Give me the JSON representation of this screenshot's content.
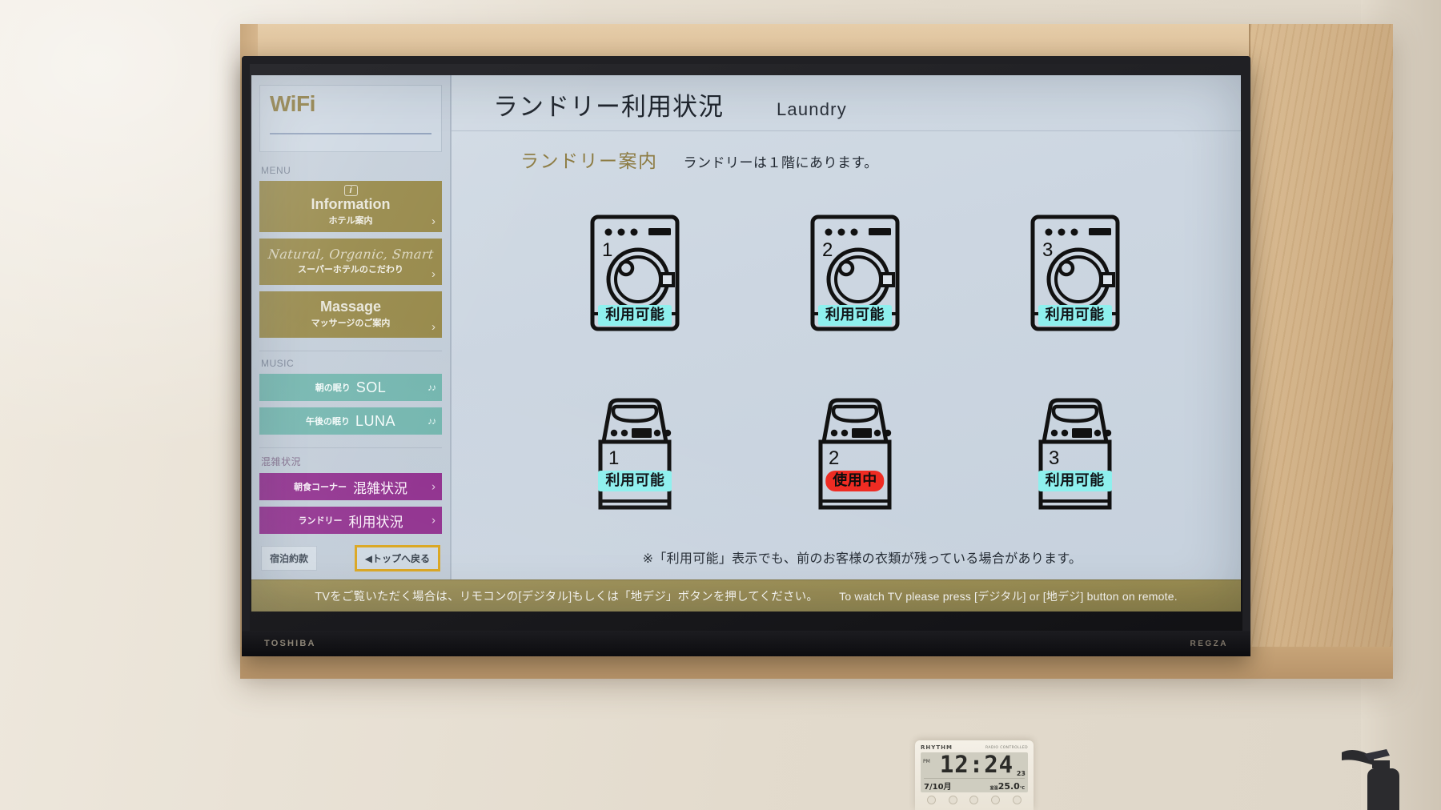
{
  "tv": {
    "brand_left": "TOSHIBA",
    "brand_right": "REGZA"
  },
  "sidebar": {
    "wifi_title": "WiFi",
    "menu_label": "MENU",
    "music_label": "MUSIC",
    "congestion_label": "混雑状況",
    "menu_items": [
      {
        "icon": "info-icon",
        "en": "Information",
        "ja": "ホテル案内",
        "chevron": "›"
      },
      {
        "script": "Natural, Organic, Smart",
        "ja": "スーパーホテルのこだわり",
        "chevron": "›"
      },
      {
        "en": "Massage",
        "ja": "マッサージのご案内",
        "chevron": "›"
      }
    ],
    "music_items": [
      {
        "ja": "朝の眠り",
        "en": "SOL",
        "note": "♪♪"
      },
      {
        "ja": "午後の眠り",
        "en": "LUNA",
        "note": "♪♪"
      }
    ],
    "congestion_items": [
      {
        "ja_small": "朝食コーナー",
        "ja_big": "混雑状況",
        "chevron": "›"
      },
      {
        "ja_small": "ランドリー",
        "ja_big": "利用状況",
        "chevron": "›"
      }
    ],
    "terms_button": "宿泊約款",
    "top_button": "◀トップへ戻る"
  },
  "main": {
    "title_ja": "ランドリー利用状況",
    "title_en": "Laundry",
    "sub_ja": "ランドリー案内",
    "sub_note": "ランドリーは１階にあります。",
    "footnote": "※「利用可能」表示でも、前のお客様の衣類が残っている場合があります。",
    "machines": [
      {
        "type": "washer",
        "number": "1",
        "status": "利用可能",
        "state": "available"
      },
      {
        "type": "washer",
        "number": "2",
        "status": "利用可能",
        "state": "available"
      },
      {
        "type": "washer",
        "number": "3",
        "status": "利用可能",
        "state": "available"
      },
      {
        "type": "dryer",
        "number": "1",
        "status": "利用可能",
        "state": "available"
      },
      {
        "type": "dryer",
        "number": "2",
        "status": "使用中",
        "state": "inuse"
      },
      {
        "type": "dryer",
        "number": "3",
        "status": "利用可能",
        "state": "available"
      }
    ]
  },
  "status_band": {
    "ja": "TVをご覧いただく場合は、リモコンの[デジタル]もしくは「地デジ」ボタンを押してください。",
    "en": "To watch TV please press [デジタル] or [地デジ] button on remote."
  },
  "clock": {
    "brand": "RHYTHM",
    "sub": "RADIO CONTROLLED",
    "pm": "PM",
    "time": "12:24",
    "seconds": "23",
    "date": "7/10月",
    "temp_label": "室温",
    "temp": "25.0",
    "temp_unit": "°C"
  },
  "colors": {
    "gold_menu": "#97894a",
    "teal_menu": "#72b5ae",
    "purple_menu": "#8e2c8c",
    "available_badge": "#8ef0ee",
    "inuse_badge": "#ef2b22",
    "status_band": "#948747",
    "accent_gold_text": "#8d7c43"
  }
}
